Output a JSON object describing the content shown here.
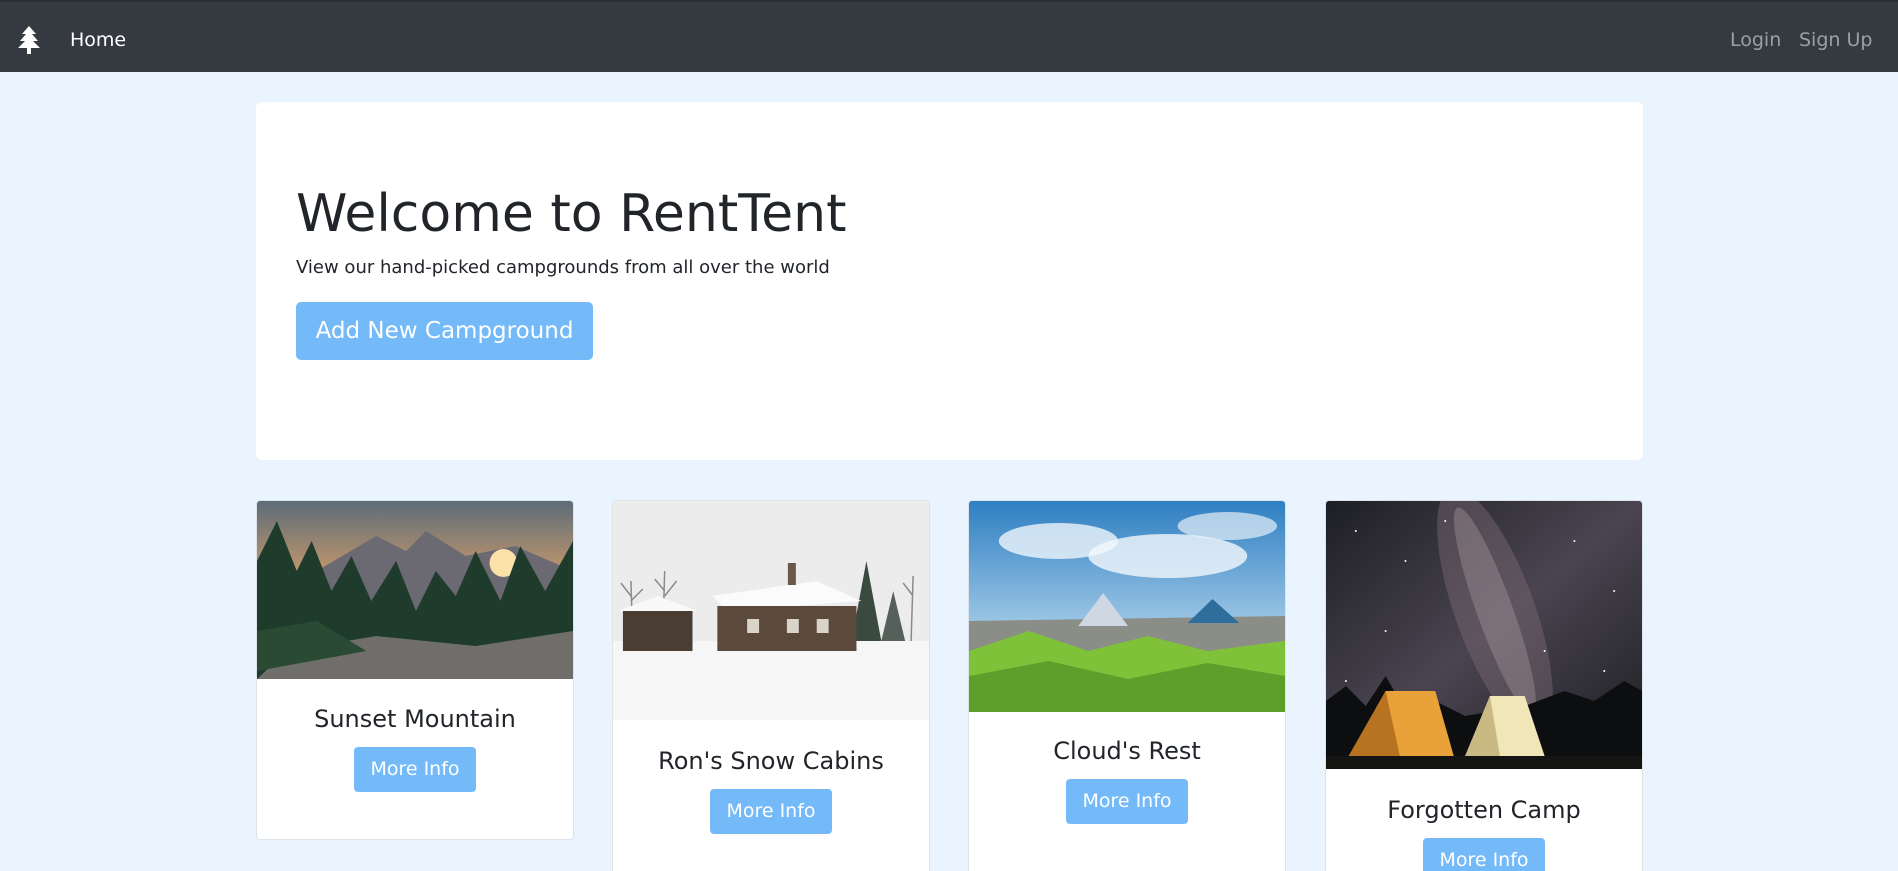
{
  "nav": {
    "brand_icon": "tree-icon",
    "home_label": "Home",
    "login_label": "Login",
    "signup_label": "Sign Up"
  },
  "jumbotron": {
    "title": "Welcome to RentTent",
    "subtitle": "View our hand-picked campgrounds from all over the world",
    "add_button": "Add New Campground"
  },
  "campgrounds": [
    {
      "name": "Sunset Mountain",
      "button": "More Info"
    },
    {
      "name": "Ron's Snow Cabins",
      "button": "More Info"
    },
    {
      "name": "Cloud's Rest",
      "button": "More Info"
    },
    {
      "name": "Forgotten Camp",
      "button": "More Info"
    }
  ],
  "colors": {
    "navbar": "#343a40",
    "background": "#eaf4fe",
    "accent": "#74b9f8"
  }
}
